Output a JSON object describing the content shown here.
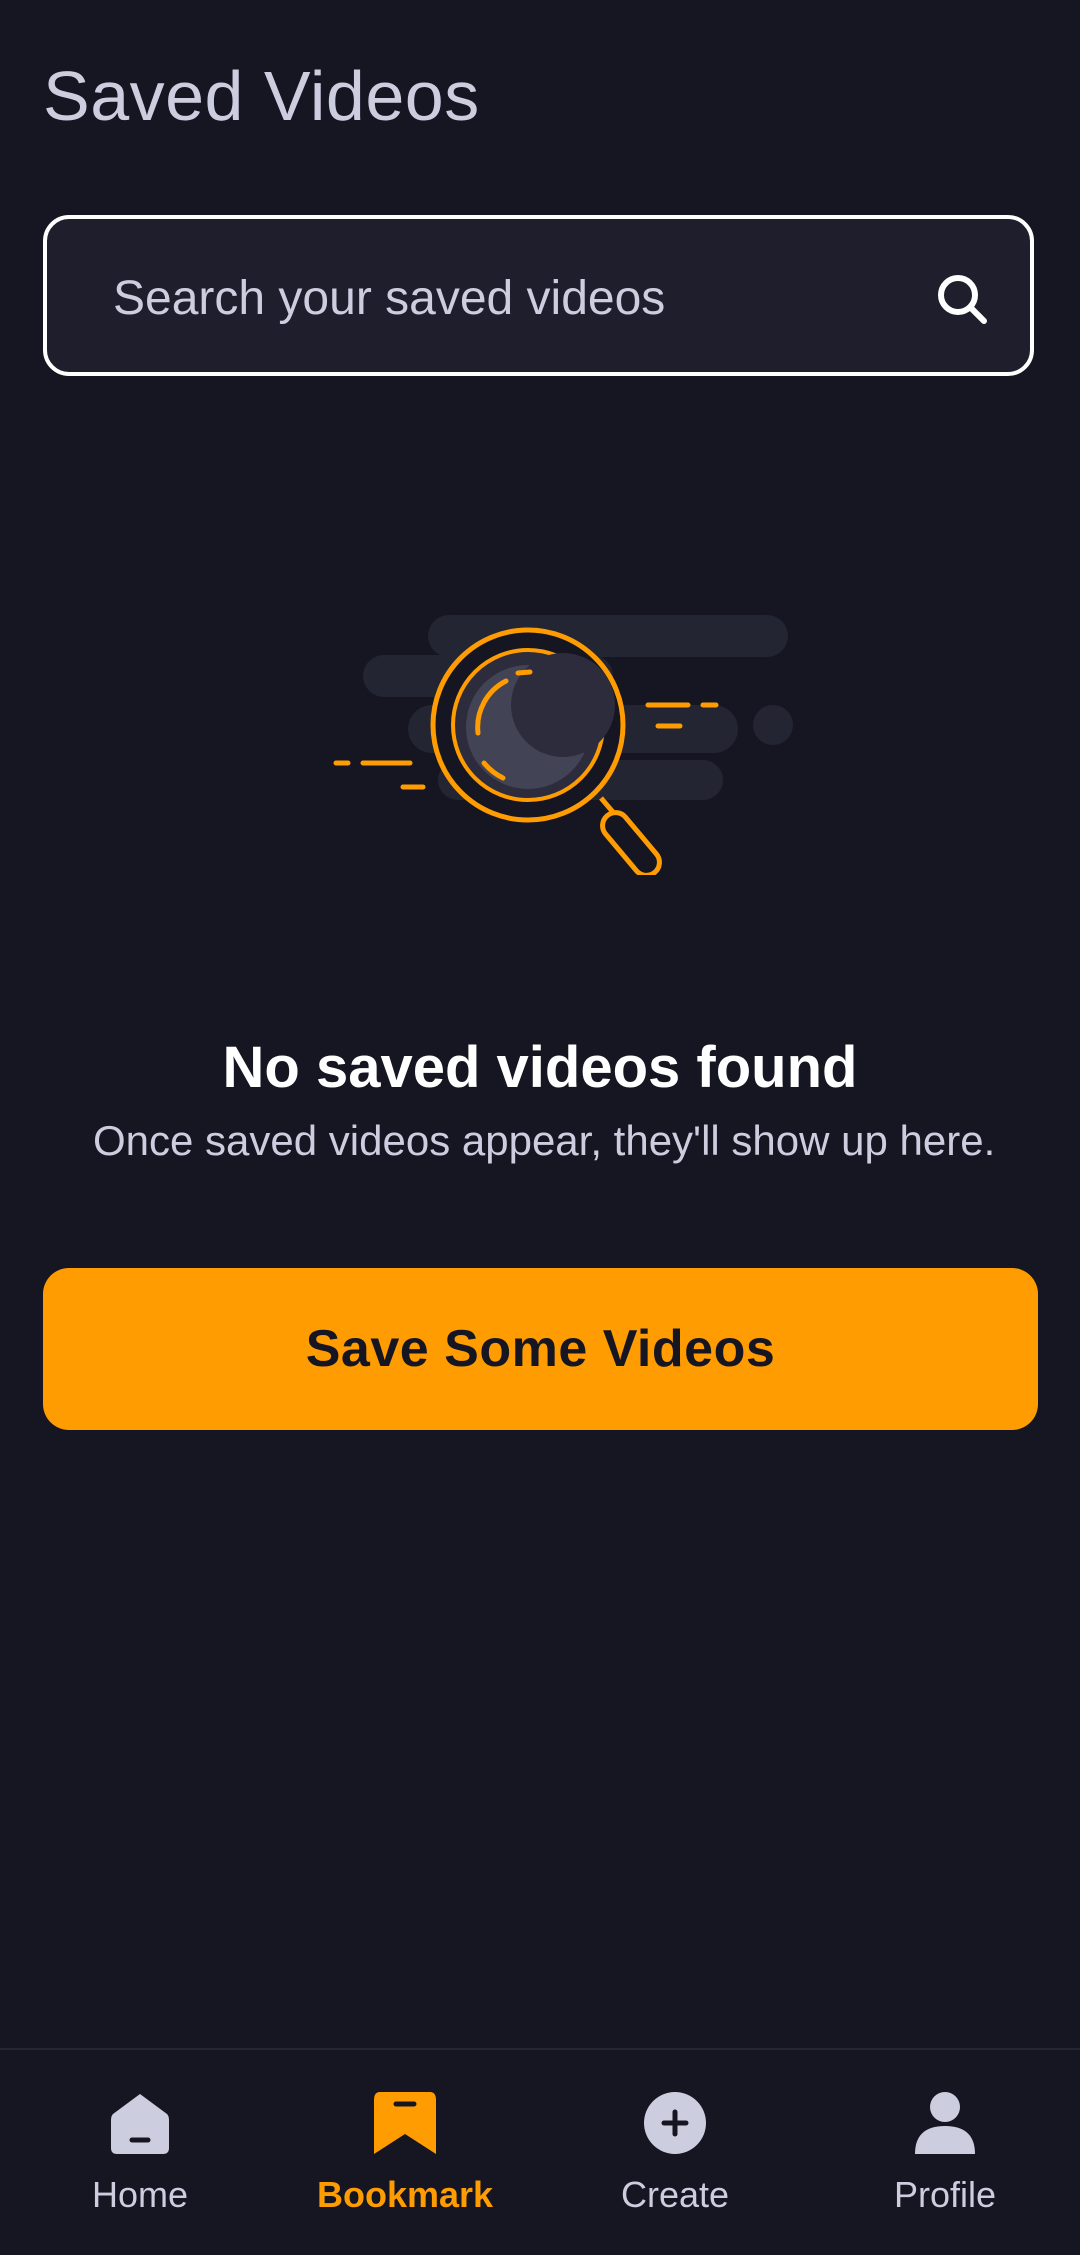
{
  "header": {
    "title": "Saved Videos"
  },
  "search": {
    "placeholder": "Search your saved videos",
    "value": ""
  },
  "empty_state": {
    "title": "No saved videos found",
    "subtitle": "Once saved videos appear, they'll show up here.",
    "cta_label": "Save Some Videos",
    "illustration_icon": "magnifier-illustration"
  },
  "tabbar": {
    "items": [
      {
        "label": "Home",
        "icon": "home-icon",
        "active": false
      },
      {
        "label": "Bookmark",
        "icon": "bookmark-icon",
        "active": true
      },
      {
        "label": "Create",
        "icon": "plus-circle-icon",
        "active": false
      },
      {
        "label": "Profile",
        "icon": "profile-icon",
        "active": false
      }
    ]
  },
  "colors": {
    "background": "#161622",
    "accent": "#ff9c01",
    "text_muted": "#cdcde0",
    "surface": "#1e1e2d"
  }
}
